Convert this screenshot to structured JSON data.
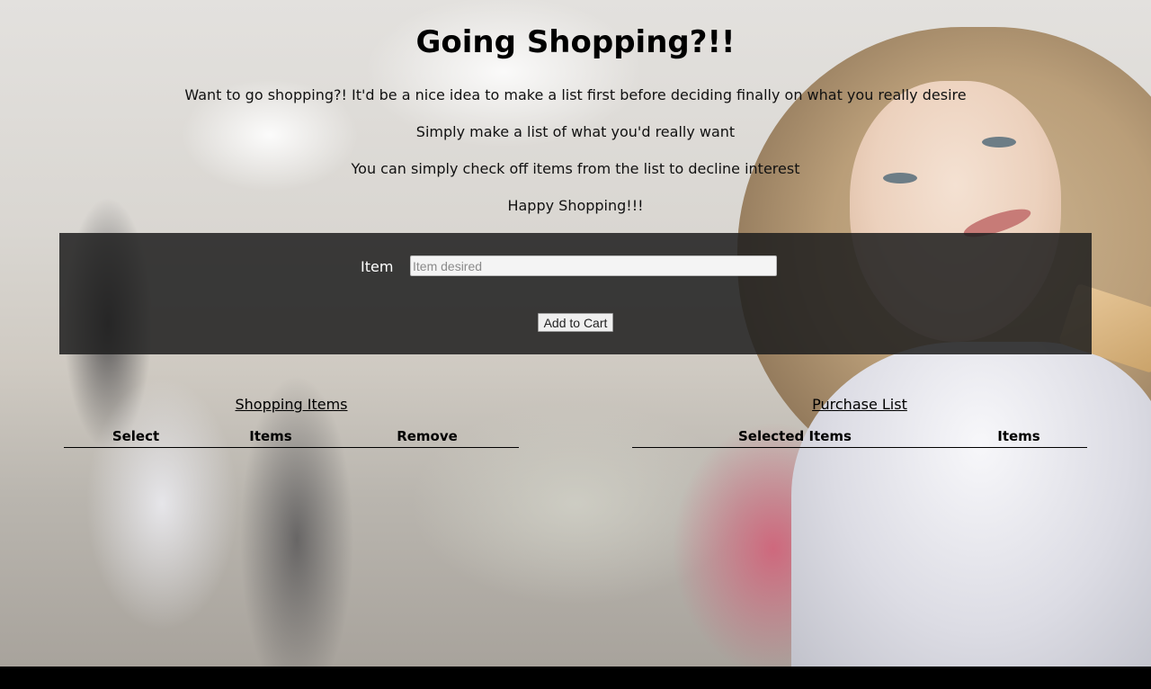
{
  "page": {
    "title": "Going Shopping?!!",
    "intro_lines": [
      "Want to go shopping?! It'd be a nice idea to make a list first before deciding finally on what you really desire",
      "Simply make a list of what you'd really want",
      "You can simply check off items from the list to decline interest",
      "Happy Shopping!!!"
    ]
  },
  "form": {
    "item_label": "Item",
    "item_placeholder": "Item desired",
    "item_value": "",
    "add_button_label": "Add to Cart"
  },
  "shopping_items": {
    "title": "Shopping Items",
    "columns": [
      "Select",
      "Items",
      "Remove"
    ],
    "rows": []
  },
  "purchase_list": {
    "title": "Purchase List",
    "columns": [
      "Selected Items",
      "Items"
    ],
    "rows": []
  },
  "colors": {
    "panel_background": "#1e1e1e",
    "text": "#000000",
    "panel_text": "#ffffff"
  }
}
